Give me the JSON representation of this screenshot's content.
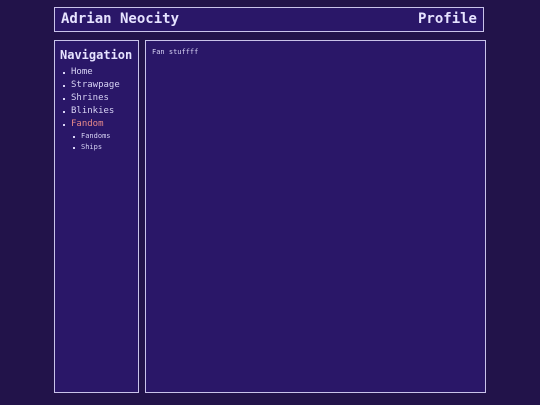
{
  "header": {
    "site_title": "Adrian Neocity",
    "page_name": "Profile"
  },
  "sidebar": {
    "title": "Navigation",
    "items": [
      {
        "label": "Home"
      },
      {
        "label": "Strawpage"
      },
      {
        "label": "Shrines"
      },
      {
        "label": "Blinkies"
      },
      {
        "label": "Fandom",
        "active": true
      }
    ],
    "sub_items": [
      {
        "label": "Fandoms"
      },
      {
        "label": "Ships"
      }
    ]
  },
  "main": {
    "text": "Fan stuffff"
  },
  "colors": {
    "background": "#22134a",
    "panel": "#2a1768",
    "border": "#c9c3ea",
    "text": "#e6e3ff",
    "active_link": "#e88a8a"
  }
}
